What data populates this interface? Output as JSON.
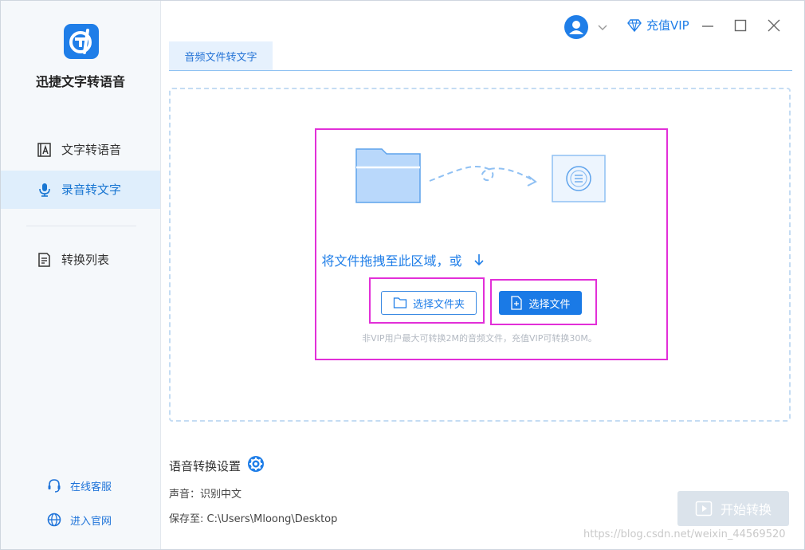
{
  "app": {
    "name": "迅捷文字转语音"
  },
  "sidebar": {
    "items": [
      {
        "label": "文字转语音"
      },
      {
        "label": "录音转文字"
      },
      {
        "label": "转换列表"
      }
    ],
    "links": [
      {
        "label": "在线客服"
      },
      {
        "label": "进入官网"
      }
    ]
  },
  "topbar": {
    "vip_label": "充值VIP"
  },
  "tabs": [
    {
      "label": "音频文件转文字"
    }
  ],
  "dropzone": {
    "prompt": "将文件拖拽至此区域，或",
    "select_folder_label": "选择文件夹",
    "select_file_label": "选择文件",
    "note": "非VIP用户最大可转换2M的音频文件，充值VIP可转换30M。"
  },
  "settings": {
    "title": "语音转换设置",
    "voice_label": "声音：",
    "voice_value": "识别中文",
    "save_label": "保存至:",
    "save_path": "C:\\Users\\Mloong\\Desktop",
    "start_label": "开始转换"
  },
  "watermark": "https://blog.csdn.net/weixin_44569520",
  "colors": {
    "accent": "#1f7ee8",
    "highlight": "#e22fd8",
    "active_bg": "#dfeefc"
  }
}
